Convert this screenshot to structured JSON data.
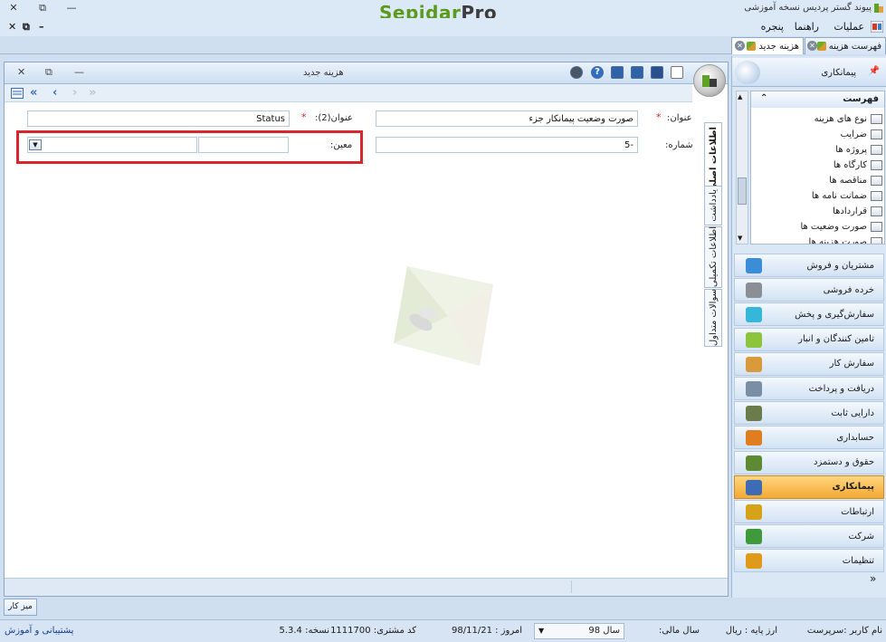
{
  "titlebar": {
    "app_title": "پیوند گستر پردیس نسخه آموزشی",
    "logo_part1": "Sepidar",
    "logo_part2": "Pro",
    "close": "✕",
    "restore": "⧉",
    "minimize": "—"
  },
  "menubar": {
    "items": [
      "عملیات",
      "راهنما",
      "پنجره"
    ],
    "mdi_close": "✕",
    "mdi_restore": "⧉",
    "mdi_minimize": "–"
  },
  "tabs": [
    {
      "label": "فهرست هزینه"
    },
    {
      "label": "هزینه جدید"
    }
  ],
  "form": {
    "title": "هزینه جدید",
    "close": "✕",
    "restore": "⧉",
    "minimize": "—",
    "fields": {
      "title_label": "عنوان:",
      "title_value": "صورت وضعیت پیمانکار جزء",
      "title2_label": "عنوان(2):",
      "title2_value": "Status",
      "number_label": "شماره:",
      "number_value": "5-",
      "moein_label": "معین:",
      "moein_code": "",
      "moein_name": "",
      "req": "*"
    },
    "vertical_tabs": [
      "اطلاعات اصلی",
      "یادداشت",
      "اطلاعات تکمیلی",
      "سوالات متداول"
    ],
    "nav": {
      "first": "«",
      "prev": "‹",
      "next": "›",
      "last": "»"
    }
  },
  "rightpanel": {
    "title": "پیمانکاری",
    "pin": "ᵖ",
    "list_title": "فهرست",
    "list_items": [
      "نوع های هزینه",
      "ضرایب",
      "پروژه ها",
      "کارگاه ها",
      "مناقصه ها",
      "ضمانت نامه ها",
      "قراردادها",
      "صورت وضعیت ها",
      "صورت هزینه ها"
    ],
    "modules": [
      {
        "label": "مشتریان و فروش",
        "color": "#3c8dd8"
      },
      {
        "label": "خرده فروشی",
        "color": "#8a8f96"
      },
      {
        "label": "سفارش‌گیری و پخش",
        "color": "#36b6d9"
      },
      {
        "label": "تامین کنندگان و انبار",
        "color": "#8cc43c"
      },
      {
        "label": "سفارش کار",
        "color": "#d99a3b"
      },
      {
        "label": "دریافت و پرداخت",
        "color": "#7a8fa6"
      },
      {
        "label": "دارایی ثابت",
        "color": "#6a7b4c"
      },
      {
        "label": "حسابداری",
        "color": "#e07d1e"
      },
      {
        "label": "حقوق و دستمزد",
        "color": "#5d8a33"
      },
      {
        "label": "پیمانکاری",
        "color": "#3d6bb4"
      },
      {
        "label": "ارتباطات",
        "color": "#d6a318"
      },
      {
        "label": "شرکت",
        "color": "#3f9a3b"
      },
      {
        "label": "تنظیمات",
        "color": "#e09a1a"
      }
    ],
    "more": "»"
  },
  "bottom": {
    "desk_tab": "میز کار",
    "user": "نام کاربر :سرپرست",
    "base_currency": "ارز پایه : ریال",
    "fiscal_year_label": "سال مالی:",
    "fiscal_year_value": "سال 98",
    "today": "امروز : 98/11/21",
    "customer_code": "کد مشتری: 1111700",
    "version": "نسخه: 5.3.4",
    "support": "پشتیبانی و آموزش"
  }
}
